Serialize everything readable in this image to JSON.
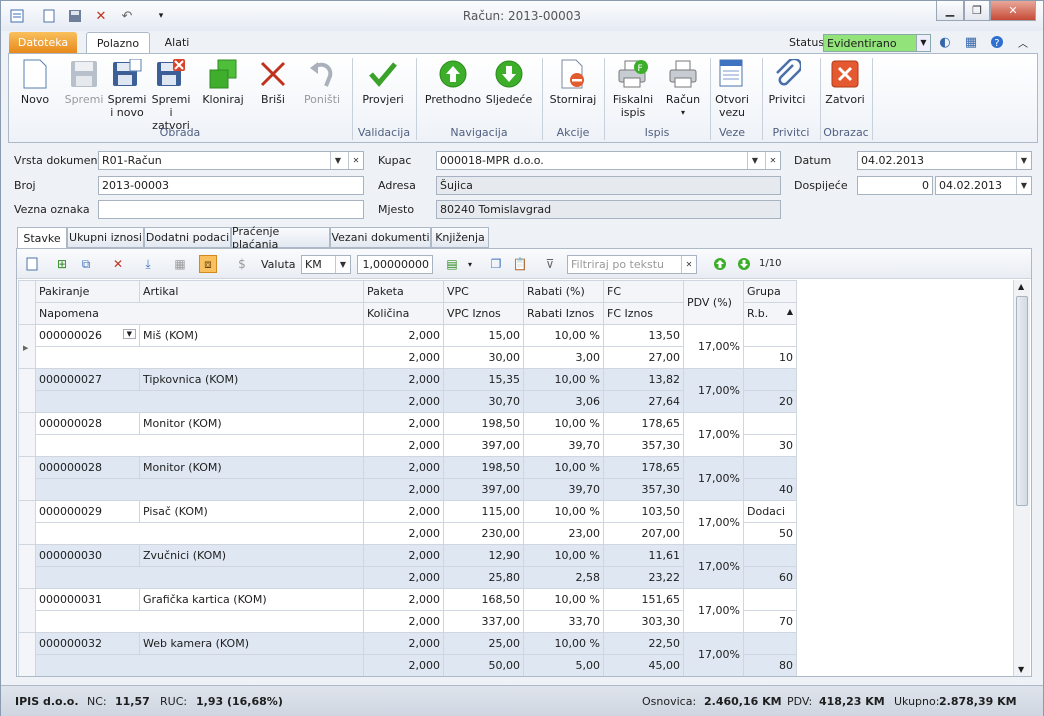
{
  "window": {
    "title": "Račun: 2013-00003",
    "min": "▁",
    "max": "❐",
    "close": "✕"
  },
  "ribbon_tabs": {
    "file": "Datoteka",
    "active": "Polazno",
    "other": "Alati"
  },
  "status_field": {
    "label": "Status",
    "value": "Evidentirano"
  },
  "ribbon": {
    "buttons": {
      "novo": "Novo",
      "spremi": "Spremi",
      "spremi_novo": "Spremi\ni novo",
      "spremi_zatvori": "Spremi i\nzatvori",
      "kloniraj": "Kloniraj",
      "brisi": "Briši",
      "ponisti": "Poništi",
      "provjeri": "Provjeri",
      "prethodno": "Prethodno",
      "sljedece": "Sljedeće",
      "storniraj": "Storniraj",
      "fiskalni": "Fiskalni\nispis",
      "racun": "Račun",
      "otvori_vezu": "Otvori\nvezu",
      "privitci": "Privitci",
      "zatvori": "Zatvori"
    },
    "groups": {
      "obrada": "Obrada",
      "validacija": "Validacija",
      "navigacija": "Navigacija",
      "akcije": "Akcije",
      "ispis": "Ispis",
      "veze": "Veze",
      "privitci": "Privitci",
      "obrazac": "Obrazac"
    }
  },
  "form": {
    "vrsta_label": "Vrsta dokumenta",
    "vrsta_value": "R01-Račun",
    "broj_label": "Broj",
    "broj_value": "2013-00003",
    "vezna_label": "Vezna oznaka",
    "vezna_value": "",
    "kupac_label": "Kupac",
    "kupac_value": "000018-MPR d.o.o.",
    "adresa_label": "Adresa",
    "adresa_value": "Šujica",
    "mjesto_label": "Mjesto",
    "mjesto_value": "80240 Tomislavgrad",
    "datum_label": "Datum",
    "datum_value": "04.02.2013",
    "dospijece_label": "Dospijeće",
    "dospijece_days": "0",
    "dospijece_date": "04.02.2013"
  },
  "doc_tabs": [
    "Stavke",
    "Ukupni iznosi",
    "Dodatni podaci",
    "Praćenje plaćanja",
    "Vezani dokumenti",
    "Knjiženja"
  ],
  "toolbar": {
    "valuta_label": "Valuta",
    "valuta_value": "KM",
    "tecaj": "1,00000000",
    "filter_placeholder": "Filtriraj po tekstu",
    "pager": "1/10"
  },
  "grid": {
    "headers_top": [
      "Pakiranje",
      "Artikal",
      "Paketa",
      "VPC",
      "Rabati (%)",
      "FC",
      "PDV (%)",
      "Grupa"
    ],
    "headers_bottom": [
      "Napomena",
      "Količina",
      "VPC Iznos",
      "Rabati Iznos",
      "FC Iznos",
      "R.b."
    ],
    "rows": [
      {
        "pak": "000000026",
        "art": "Miš (KOM)",
        "paketa": "2,000",
        "vpc": "15,00",
        "rab": "10,00 %",
        "fc": "13,50",
        "pdv": "17,00%",
        "grupa": "",
        "kol": "2,000",
        "vpci": "30,00",
        "rabi": "3,00",
        "fci": "27,00",
        "rb": "10"
      },
      {
        "pak": "000000027",
        "art": "Tipkovnica (KOM)",
        "paketa": "2,000",
        "vpc": "15,35",
        "rab": "10,00 %",
        "fc": "13,82",
        "pdv": "17,00%",
        "grupa": "",
        "kol": "2,000",
        "vpci": "30,70",
        "rabi": "3,06",
        "fci": "27,64",
        "rb": "20"
      },
      {
        "pak": "000000028",
        "art": "Monitor (KOM)",
        "paketa": "2,000",
        "vpc": "198,50",
        "rab": "10,00 %",
        "fc": "178,65",
        "pdv": "17,00%",
        "grupa": "",
        "kol": "2,000",
        "vpci": "397,00",
        "rabi": "39,70",
        "fci": "357,30",
        "rb": "30"
      },
      {
        "pak": "000000028",
        "art": "Monitor (KOM)",
        "paketa": "2,000",
        "vpc": "198,50",
        "rab": "10,00 %",
        "fc": "178,65",
        "pdv": "17,00%",
        "grupa": "",
        "kol": "2,000",
        "vpci": "397,00",
        "rabi": "39,70",
        "fci": "357,30",
        "rb": "40"
      },
      {
        "pak": "000000029",
        "art": "Pisač (KOM)",
        "paketa": "2,000",
        "vpc": "115,00",
        "rab": "10,00 %",
        "fc": "103,50",
        "pdv": "17,00%",
        "grupa": "Dodaci",
        "kol": "2,000",
        "vpci": "230,00",
        "rabi": "23,00",
        "fci": "207,00",
        "rb": "50"
      },
      {
        "pak": "000000030",
        "art": "Zvučnici (KOM)",
        "paketa": "2,000",
        "vpc": "12,90",
        "rab": "10,00 %",
        "fc": "11,61",
        "pdv": "17,00%",
        "grupa": "",
        "kol": "2,000",
        "vpci": "25,80",
        "rabi": "2,58",
        "fci": "23,22",
        "rb": "60"
      },
      {
        "pak": "000000031",
        "art": "Grafička kartica (KOM)",
        "paketa": "2,000",
        "vpc": "168,50",
        "rab": "10,00 %",
        "fc": "151,65",
        "pdv": "17,00%",
        "grupa": "",
        "kol": "2,000",
        "vpci": "337,00",
        "rabi": "33,70",
        "fci": "303,30",
        "rb": "70"
      },
      {
        "pak": "000000032",
        "art": "Web kamera (KOM)",
        "paketa": "2,000",
        "vpc": "25,00",
        "rab": "10,00 %",
        "fc": "22,50",
        "pdv": "17,00%",
        "grupa": "",
        "kol": "2,000",
        "vpci": "50,00",
        "rabi": "5,00",
        "fci": "45,00",
        "rb": "80"
      }
    ]
  },
  "statusbar": {
    "company": "IPIS d.o.o.",
    "nc_label": "NC:",
    "nc_value": "11,57",
    "ruc_label": "RUC:",
    "ruc_value": "1,93 (16,68%)",
    "osnovica_label": "Osnovica:",
    "osnovica_value": "2.460,16 KM",
    "pdv_label": "PDV:",
    "pdv_value": "418,23 KM",
    "ukupno_label": "Ukupno:",
    "ukupno_value": "2.878,39 KM"
  }
}
